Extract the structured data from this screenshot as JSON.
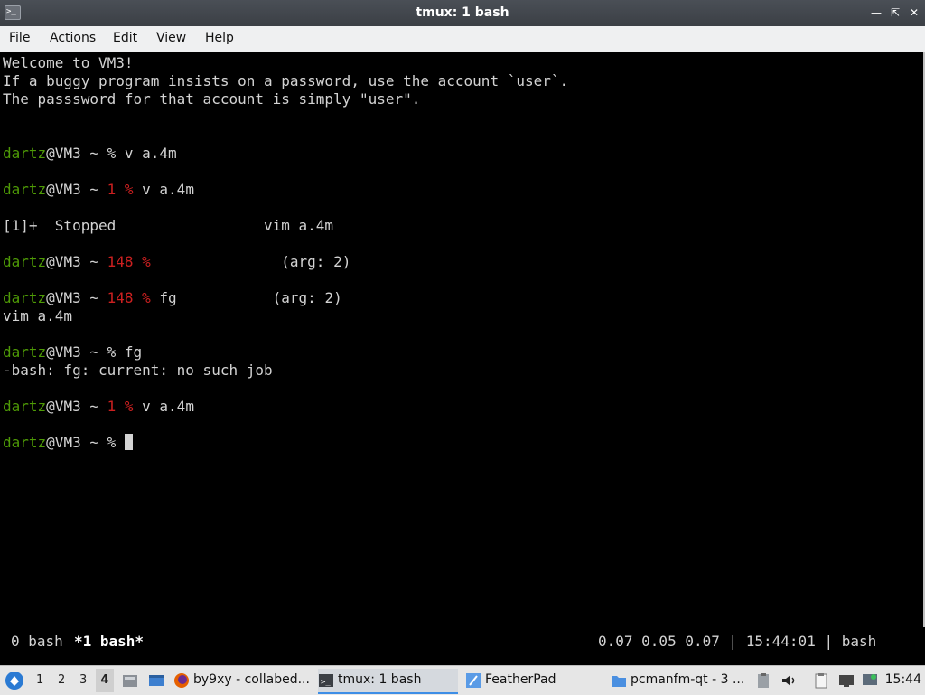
{
  "window": {
    "title": "tmux: 1 bash",
    "icon": "terminal-icon",
    "controls": [
      "minimize-icon",
      "maximize-icon",
      "close-icon"
    ]
  },
  "menubar": {
    "items": [
      "File",
      "Actions",
      "Edit",
      "View",
      "Help"
    ]
  },
  "terminal": {
    "lines": {
      "l1": "Welcome to VM3!",
      "l2": "If a buggy program insists on a password, use the account `user`.",
      "l3": "The passsword for that account is simply \"user\".",
      "p1_user": "dartz",
      "p1_host": "@VM3 ~ ",
      "p1_pct": "% ",
      "p1_cmd": "v a.4m",
      "p2_user": "dartz",
      "p2_host": "@VM3 ~ ",
      "p2_code": "1 %",
      "p2_cmd": " v a.4m",
      "stopped": "[1]+  Stopped                 vim a.4m",
      "p3_user": "dartz",
      "p3_host": "@VM3 ~ ",
      "p3_code": "148 %",
      "p3_rest": "               (arg: 2)",
      "p4_user": "dartz",
      "p4_host": "@VM3 ~ ",
      "p4_code": "148 %",
      "p4_rest": " fg           (arg: 2)",
      "vimline": "vim a.4m",
      "p5_user": "dartz",
      "p5_host": "@VM3 ~ ",
      "p5_cmd": "% fg",
      "err": "-bash: fg: current: no such job",
      "p6_user": "dartz",
      "p6_host": "@VM3 ~ ",
      "p6_code": "1 %",
      "p6_cmd": " v a.4m",
      "p7_user": "dartz",
      "p7_host": "@VM3 ~ ",
      "p7_cmd": "% "
    }
  },
  "tmux": {
    "win0": "0 bash",
    "win1": "*1 bash*",
    "right": "0.07 0.05 0.07 | 15:44:01 | bash"
  },
  "taskbar": {
    "desktops": [
      "1",
      "2",
      "3",
      "4"
    ],
    "active_desktop": "4",
    "tasks": [
      {
        "label": "by9xy - collabed...",
        "icon": "firefox-icon"
      },
      {
        "label": "tmux: 1 bash",
        "icon": "terminal-icon",
        "active": true
      },
      {
        "label": "FeatherPad",
        "icon": "featherpad-icon"
      },
      {
        "label": "pcmanfm-qt - 3 ...",
        "icon": "folder-icon"
      }
    ],
    "clock": "15:44",
    "colors": {
      "prompt_user": "#4e9a06",
      "exit_code": "#cc2020",
      "accent": "#3d8ee6"
    }
  }
}
